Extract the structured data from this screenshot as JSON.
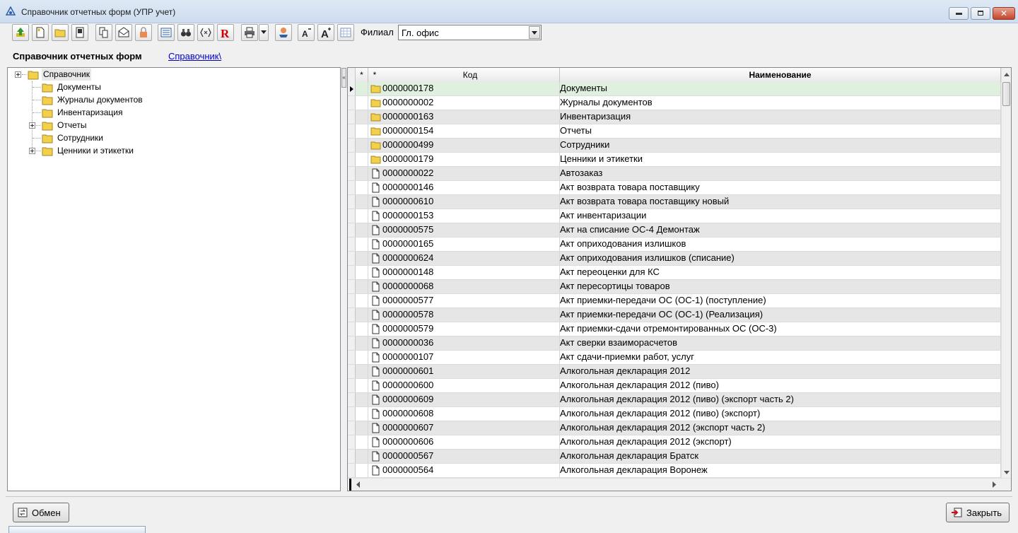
{
  "window": {
    "title": "Справочник отчетных форм (УПР учет)"
  },
  "toolbar": {
    "filial_label": "Филиал",
    "filial_value": "Гл. офис"
  },
  "heading": {
    "title": "Справочник отчетных форм",
    "breadcrumb_link": "Справочник\\"
  },
  "tree": {
    "root": "Справочник",
    "items": [
      "Документы",
      "Журналы документов",
      "Инвентаризация",
      "Отчеты",
      "Сотрудники",
      "Ценники и этикетки"
    ]
  },
  "grid": {
    "columns": [
      "*",
      "*",
      "Код",
      "Наименование"
    ],
    "rows": [
      {
        "type": "folder",
        "code": "0000000178",
        "name": "Документы"
      },
      {
        "type": "folder",
        "code": "0000000002",
        "name": "Журналы документов"
      },
      {
        "type": "folder",
        "code": "0000000163",
        "name": "Инвентаризация"
      },
      {
        "type": "folder",
        "code": "0000000154",
        "name": "Отчеты"
      },
      {
        "type": "folder",
        "code": "0000000499",
        "name": "Сотрудники"
      },
      {
        "type": "folder",
        "code": "0000000179",
        "name": "Ценники и этикетки"
      },
      {
        "type": "file",
        "code": "0000000022",
        "name": "Автозаказ"
      },
      {
        "type": "file",
        "code": "0000000146",
        "name": "Акт возврата товара поставщику"
      },
      {
        "type": "file",
        "code": "0000000610",
        "name": "Акт возврата товара поставщику новый"
      },
      {
        "type": "file",
        "code": "0000000153",
        "name": "Акт инвентаризации"
      },
      {
        "type": "file",
        "code": "0000000575",
        "name": "Акт на списание ОС-4 Демонтаж"
      },
      {
        "type": "file",
        "code": "0000000165",
        "name": "Акт оприходования излишков"
      },
      {
        "type": "file",
        "code": "0000000624",
        "name": "Акт оприходования излишков (списание)"
      },
      {
        "type": "file",
        "code": "0000000148",
        "name": "Акт переоценки для КС"
      },
      {
        "type": "file",
        "code": "0000000068",
        "name": "Акт пересортицы товаров"
      },
      {
        "type": "file",
        "code": "0000000577",
        "name": "Акт приемки-передачи ОС (ОС-1) (поступление)"
      },
      {
        "type": "file",
        "code": "0000000578",
        "name": "Акт приемки-передачи ОС (ОС-1) (Реализация)"
      },
      {
        "type": "file",
        "code": "0000000579",
        "name": "Акт приемки-сдачи отремонтированных ОС (ОС-3)"
      },
      {
        "type": "file",
        "code": "0000000036",
        "name": "Акт сверки взаиморасчетов"
      },
      {
        "type": "file",
        "code": "0000000107",
        "name": "Акт сдачи-приемки работ, услуг"
      },
      {
        "type": "file",
        "code": "0000000601",
        "name": "Алкогольная декларация 2012"
      },
      {
        "type": "file",
        "code": "0000000600",
        "name": "Алкогольная декларация 2012 (пиво)"
      },
      {
        "type": "file",
        "code": "0000000609",
        "name": "Алкогольная декларация 2012 (пиво) (экспорт часть 2)"
      },
      {
        "type": "file",
        "code": "0000000608",
        "name": "Алкогольная декларация 2012 (пиво) (экспорт)"
      },
      {
        "type": "file",
        "code": "0000000607",
        "name": "Алкогольная декларация 2012 (экспорт часть 2)"
      },
      {
        "type": "file",
        "code": "0000000606",
        "name": "Алкогольная декларация 2012 (экспорт)"
      },
      {
        "type": "file",
        "code": "0000000567",
        "name": "Алкогольная декларация Братск"
      },
      {
        "type": "file",
        "code": "0000000564",
        "name": "Алкогольная декларация Воронеж"
      }
    ]
  },
  "buttons": {
    "exchange": "Обмен",
    "close": "Закрыть"
  },
  "colors": {
    "selected_row": "#dff0df",
    "alt_row": "#e6e6e6",
    "link": "#0000cc"
  }
}
